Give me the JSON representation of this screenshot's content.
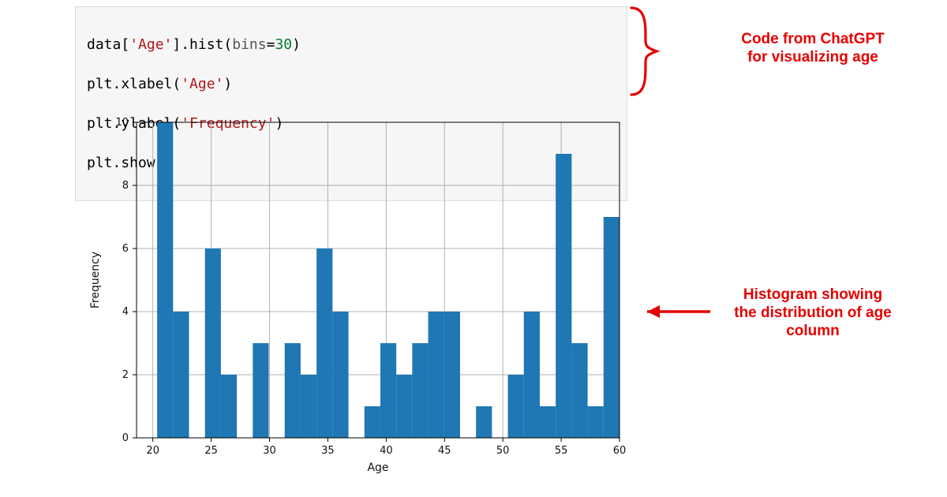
{
  "code": {
    "line1_a": "data[",
    "line1_str": "'Age'",
    "line1_b": "].hist(",
    "line1_kw": "bins",
    "line1_eq": "=",
    "line1_num": "30",
    "line1_c": ")",
    "line2_a": "plt.xlabel(",
    "line2_str": "'Age'",
    "line2_b": ")",
    "line3_a": "plt.ylabel(",
    "line3_str": "'Frequency'",
    "line3_b": ")",
    "line4": "plt.show()"
  },
  "annotations": {
    "code_label": "Code from ChatGPT\nfor visualizing age",
    "hist_label": "Histogram showing\nthe distribution of age\ncolumn"
  },
  "chart_data": {
    "type": "bar",
    "title": "",
    "xlabel": "Age",
    "ylabel": "Frequency",
    "xlim": [
      18.6,
      60.0
    ],
    "ylim": [
      0,
      10
    ],
    "xticks": [
      20,
      25,
      30,
      35,
      40,
      45,
      50,
      55,
      60
    ],
    "yticks": [
      0,
      2,
      4,
      6,
      8,
      10
    ],
    "bin_edges": [
      19.0,
      20.367,
      21.733,
      23.1,
      24.467,
      25.833,
      27.2,
      28.567,
      29.933,
      31.3,
      32.667,
      34.033,
      35.4,
      36.767,
      38.133,
      39.5,
      40.867,
      42.233,
      43.6,
      44.967,
      46.333,
      47.7,
      49.067,
      50.433,
      51.8,
      53.167,
      54.533,
      55.9,
      57.267,
      58.633,
      60.0
    ],
    "counts": [
      0,
      10,
      4,
      0,
      6,
      2,
      0,
      3,
      0,
      3,
      2,
      6,
      4,
      0,
      1,
      3,
      2,
      3,
      4,
      4,
      0,
      1,
      0,
      2,
      4,
      1,
      9,
      3,
      1,
      7
    ]
  }
}
